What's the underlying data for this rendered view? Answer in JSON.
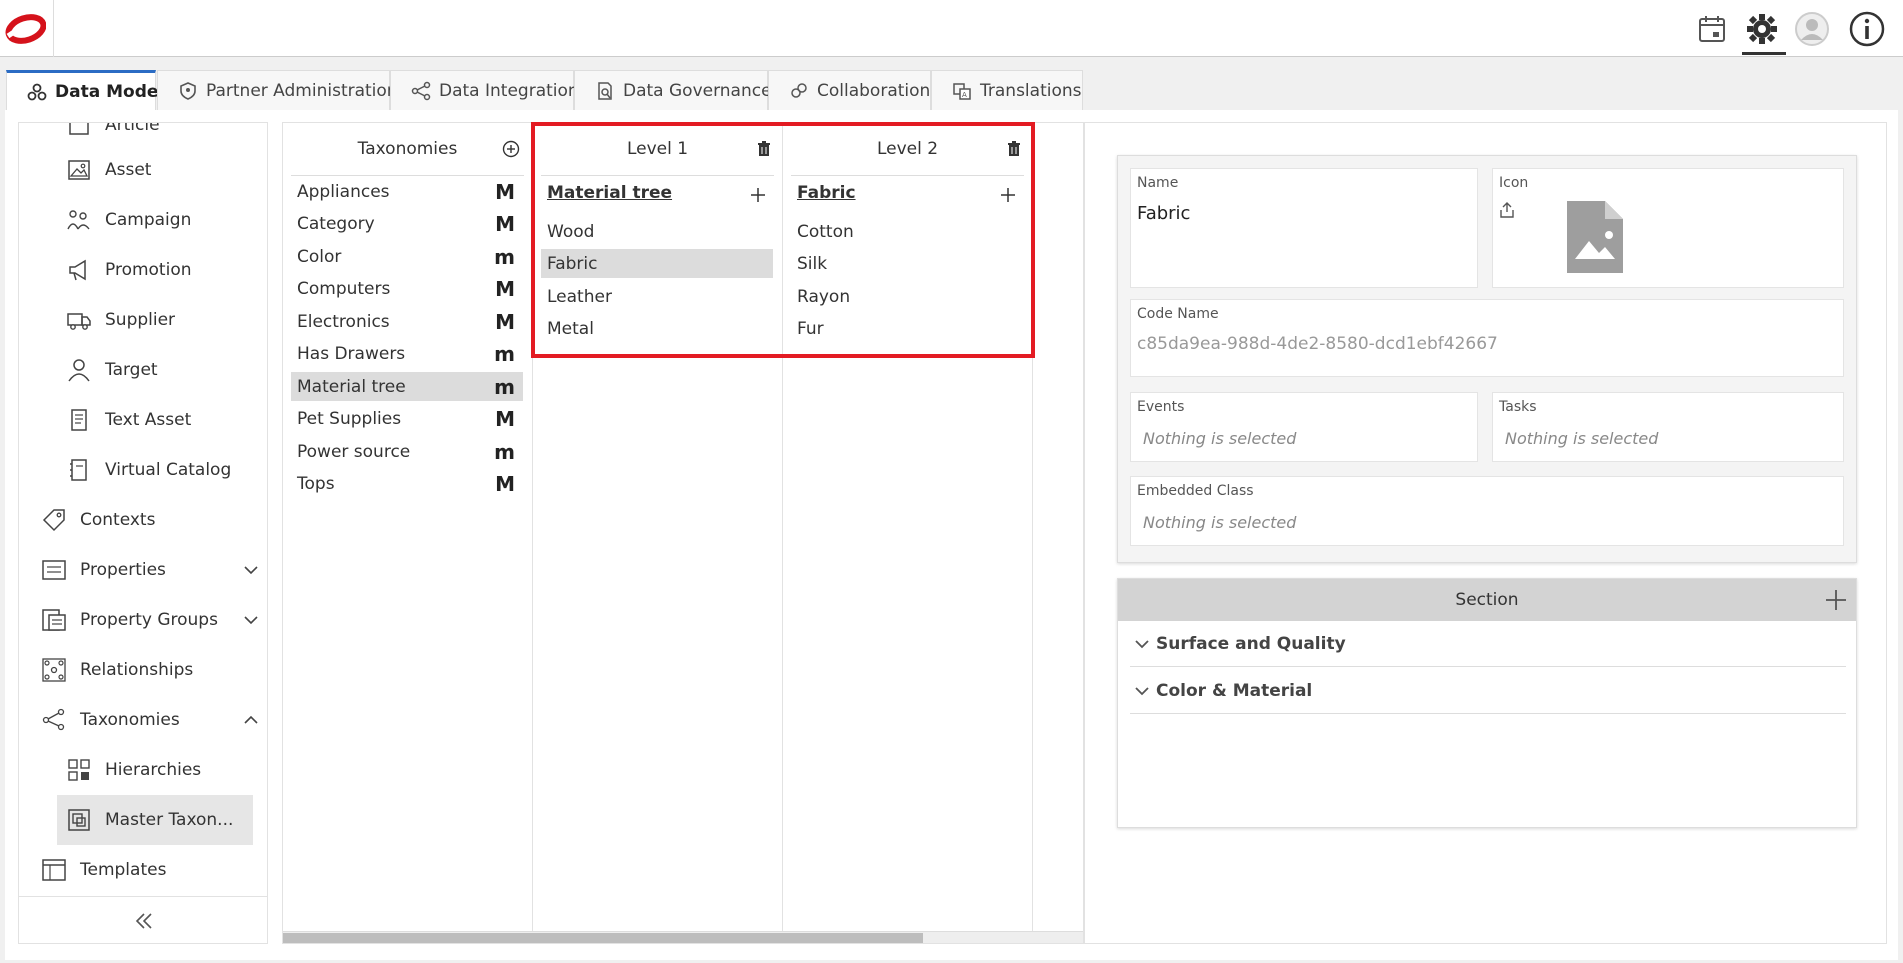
{
  "header": {
    "icons": [
      "calendar-icon",
      "settings-icon",
      "user-avatar-icon",
      "info-icon"
    ]
  },
  "tabs": [
    {
      "label": "Data Model",
      "icon": "data-model-icon",
      "active": true
    },
    {
      "label": "Partner Administration",
      "icon": "shield-icon",
      "active": false
    },
    {
      "label": "Data Integration",
      "icon": "integration-icon",
      "active": false
    },
    {
      "label": "Data Governance",
      "icon": "governance-icon",
      "active": false
    },
    {
      "label": "Collaboration",
      "icon": "collaboration-icon",
      "active": false
    },
    {
      "label": "Translations",
      "icon": "translations-icon",
      "active": false
    }
  ],
  "sidebar": {
    "items": [
      {
        "label": "Article",
        "icon": "article-icon"
      },
      {
        "label": "Asset",
        "icon": "asset-icon"
      },
      {
        "label": "Campaign",
        "icon": "campaign-icon"
      },
      {
        "label": "Promotion",
        "icon": "megaphone-icon"
      },
      {
        "label": "Supplier",
        "icon": "truck-icon"
      },
      {
        "label": "Target",
        "icon": "target-user-icon"
      },
      {
        "label": "Text Asset",
        "icon": "text-document-icon"
      },
      {
        "label": "Virtual Catalog",
        "icon": "catalog-icon"
      },
      {
        "label": "Contexts",
        "icon": "tag-icon"
      },
      {
        "label": "Properties",
        "icon": "properties-icon"
      },
      {
        "label": "Property Groups",
        "icon": "property-groups-icon"
      },
      {
        "label": "Relationships",
        "icon": "relationships-icon"
      },
      {
        "label": "Taxonomies",
        "icon": "taxonomies-icon"
      },
      {
        "label": "Hierarchies",
        "icon": "hierarchies-icon"
      },
      {
        "label": "Master Taxon...",
        "icon": "master-taxonomy-icon"
      },
      {
        "label": "Templates",
        "icon": "templates-icon"
      }
    ],
    "collapse_icon": "double-chevron-left-icon"
  },
  "taxonomies": {
    "header": "Taxonomies",
    "items": [
      {
        "label": "Appliances",
        "badge": "M"
      },
      {
        "label": "Category",
        "badge": "M"
      },
      {
        "label": "Color",
        "badge": "m"
      },
      {
        "label": "Computers",
        "badge": "M"
      },
      {
        "label": "Electronics",
        "badge": "M"
      },
      {
        "label": "Has Drawers",
        "badge": "m"
      },
      {
        "label": "Material tree",
        "badge": "m"
      },
      {
        "label": "Pet Supplies",
        "badge": "M"
      },
      {
        "label": "Power source",
        "badge": "m"
      },
      {
        "label": "Tops",
        "badge": "M"
      }
    ]
  },
  "level1": {
    "header": "Level 1",
    "parent": "Material tree",
    "items": [
      "Wood",
      "Fabric",
      "Leather",
      "Metal"
    ]
  },
  "level2": {
    "header": "Level 2",
    "parent": "Fabric",
    "items": [
      "Cotton",
      "Silk",
      "Rayon",
      "Fur"
    ]
  },
  "detail": {
    "name_label": "Name",
    "name_value": "Fabric",
    "icon_label": "Icon",
    "code_label": "Code Name",
    "code_value": "c85da9ea-988d-4de2-8580-dcd1ebf42667",
    "events_label": "Events",
    "events_placeholder": "Nothing is selected",
    "tasks_label": "Tasks",
    "tasks_placeholder": "Nothing is selected",
    "embedded_label": "Embedded Class",
    "embedded_placeholder": "Nothing is selected"
  },
  "section": {
    "header": "Section",
    "rows": [
      "Surface and Quality",
      "Color & Material"
    ]
  },
  "colors": {
    "accent": "#2b6cc4",
    "highlight": "#e31b23",
    "selected": "#dcdcdc"
  }
}
